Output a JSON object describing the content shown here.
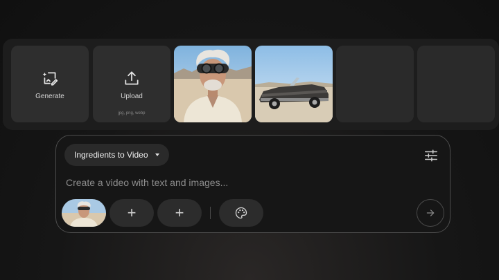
{
  "tray": {
    "generate": {
      "label": "Generate",
      "icon": "sparkle-edit-icon"
    },
    "upload": {
      "label": "Upload",
      "hint": "jpg, png, webp",
      "icon": "upload-icon"
    },
    "images": [
      {
        "subject": "man-with-goggles"
      },
      {
        "subject": "convertible-car"
      }
    ],
    "empty_slots": 2
  },
  "composer": {
    "mode_label": "Ingredients to Video",
    "prompt_placeholder": "Create a video with text and images...",
    "prompt_value": "",
    "add_icon": "+",
    "settings_icon": "sliders-icon",
    "style_icon": "palette-icon",
    "send_icon": "arrow-right-icon"
  },
  "colors": {
    "background": "#141414",
    "tile": "#2e2e2e",
    "chip": "#2c2c2c",
    "border": "#4d4d4d"
  }
}
